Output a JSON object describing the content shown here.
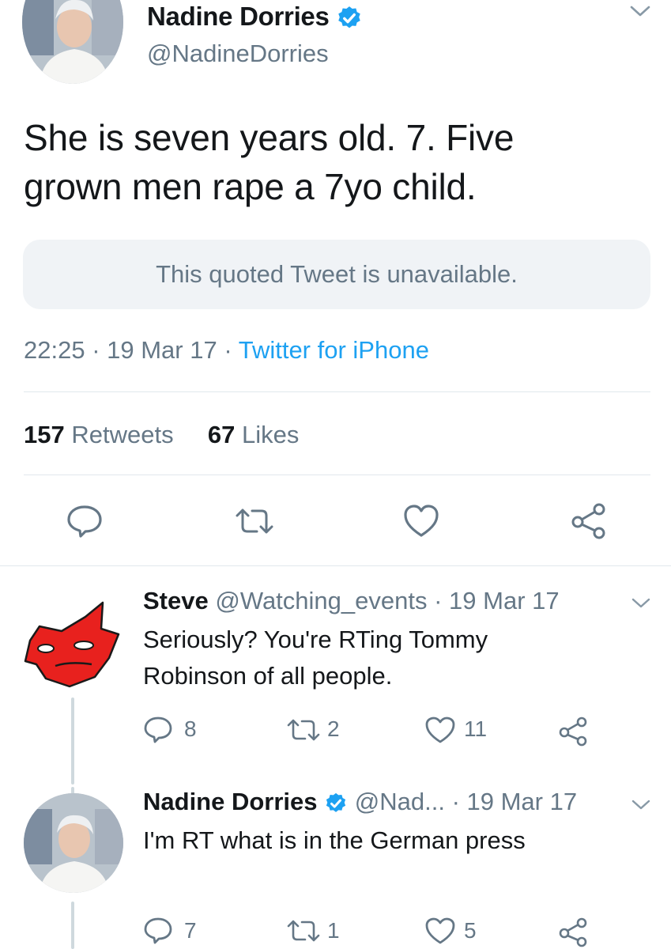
{
  "main_tweet": {
    "author_name": "Nadine Dorries",
    "author_handle": "@NadineDorries",
    "text_line1": "She is seven years old. 7. Five",
    "text_line2": "grown men rape a 7yo child.",
    "quoted_notice": "This quoted Tweet is unavailable.",
    "time": "22:25",
    "sep1": " · ",
    "date": "19 Mar 17",
    "sep2": " · ",
    "source": "Twitter for iPhone",
    "retweets_count": "157",
    "retweets_label": "Retweets",
    "likes_count": "67",
    "likes_label": "Likes"
  },
  "replies": [
    {
      "name": "Steve",
      "handle": "@Watching_events",
      "sep": " · ",
      "date": "19 Mar 17",
      "text_line1": "Seriously? You're RTing Tommy",
      "text_line2": "Robinson of all people.",
      "reply_count": "8",
      "retweet_count": "2",
      "like_count": "11"
    },
    {
      "name": "Nadine Dorries",
      "handle": "@Nad...",
      "sep": " · ",
      "date": "19 Mar 17",
      "text_line1": "I'm RT what is in the German press",
      "reply_count": "7",
      "retweet_count": "1",
      "like_count": "5"
    }
  ],
  "colors": {
    "link_blue": "#1da1f2",
    "secondary_text": "#657786",
    "primary_text": "#14171a",
    "divider": "#e1e8ed",
    "quote_bg": "#f0f3f6"
  },
  "icons": [
    "reply-icon",
    "retweet-icon",
    "like-icon",
    "share-icon",
    "verified-badge-icon",
    "chevron-down-icon"
  ]
}
